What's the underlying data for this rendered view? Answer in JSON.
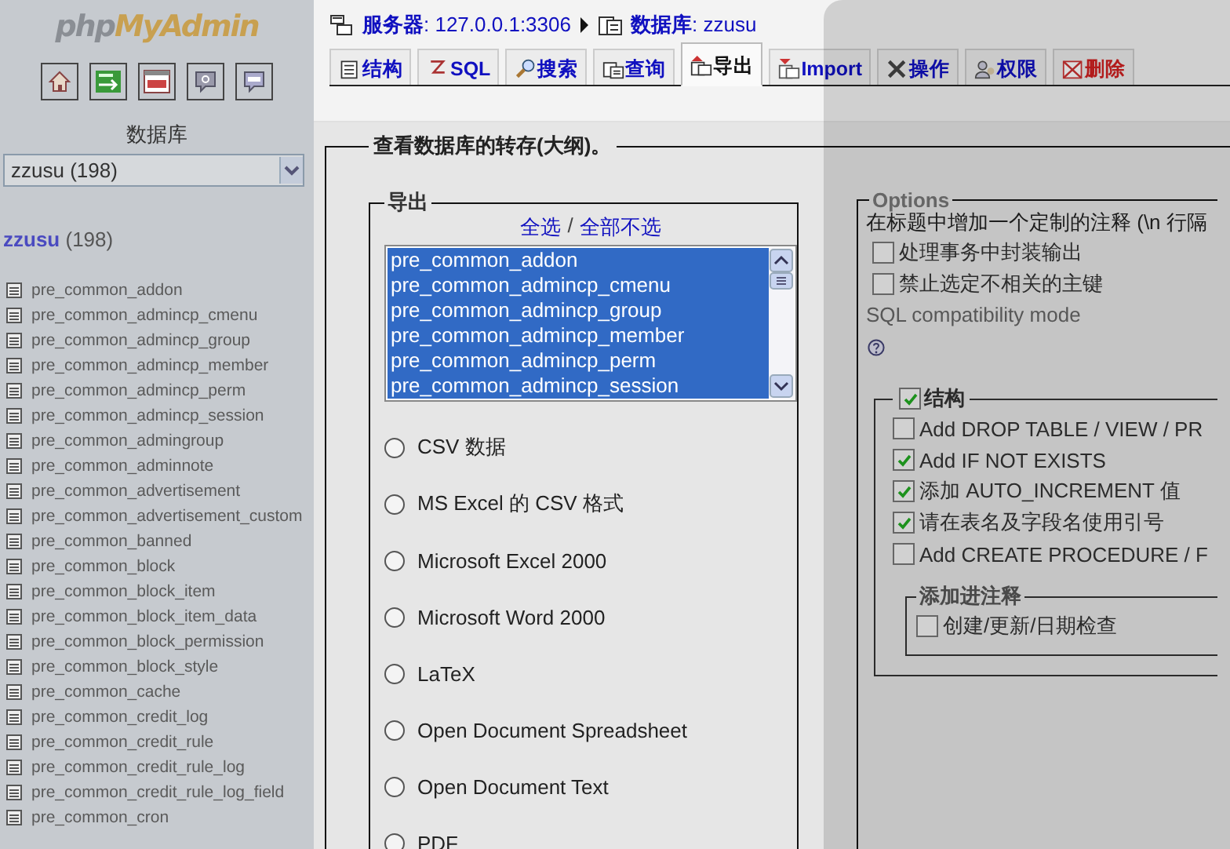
{
  "sidebar": {
    "logo": {
      "prefix": "php",
      "main": "MyAdmin"
    },
    "icon_buttons": [
      {
        "kind": "home"
      },
      {
        "kind": "exit"
      },
      {
        "kind": "sql"
      },
      {
        "kind": "help"
      },
      {
        "kind": "query"
      }
    ],
    "database_label": "数据库",
    "database_select": {
      "value": "zzusu (198)"
    },
    "current_db": {
      "name": "zzusu",
      "count": "(198)"
    },
    "tables": [
      "pre_common_addon",
      "pre_common_admincp_cmenu",
      "pre_common_admincp_group",
      "pre_common_admincp_member",
      "pre_common_admincp_perm",
      "pre_common_admincp_session",
      "pre_common_admingroup",
      "pre_common_adminnote",
      "pre_common_advertisement",
      "pre_common_advertisement_custom",
      "pre_common_banned",
      "pre_common_block",
      "pre_common_block_item",
      "pre_common_block_item_data",
      "pre_common_block_permission",
      "pre_common_block_style",
      "pre_common_cache",
      "pre_common_credit_log",
      "pre_common_credit_rule",
      "pre_common_credit_rule_log",
      "pre_common_credit_rule_log_field",
      "pre_common_cron"
    ]
  },
  "breadcrumb": {
    "server": "**服务器**: 127.0.0.1:3306",
    "database": "**数据库**: zzusu"
  },
  "tabs": [
    {
      "label": "结构",
      "kind": "structure",
      "selected": false
    },
    {
      "label": "SQL",
      "kind": "sql",
      "selected": false
    },
    {
      "label": "搜索",
      "kind": "search",
      "selected": false
    },
    {
      "label": "查询",
      "kind": "query",
      "selected": false
    },
    {
      "label": "导出",
      "kind": "export",
      "selected": true
    },
    {
      "label": "Import",
      "kind": "import",
      "selected": false
    },
    {
      "label": "操作",
      "kind": "operations",
      "selected": false
    },
    {
      "label": "权限",
      "kind": "privileges",
      "selected": false
    },
    {
      "label": "删除",
      "kind": "drop",
      "selected": false
    }
  ],
  "dump_title": "查看数据库的转存(大纲)。",
  "export": {
    "legend": "导出",
    "select_all": "全选",
    "separator": "/",
    "deselect_all": "全部不选",
    "tables": [
      {
        "name": "pre_common_addon",
        "selected": true
      },
      {
        "name": "pre_common_admincp_cmenu",
        "selected": true
      },
      {
        "name": "pre_common_admincp_group",
        "selected": true
      },
      {
        "name": "pre_common_admincp_member",
        "selected": true
      },
      {
        "name": "pre_common_admincp_perm",
        "selected": true
      },
      {
        "name": "pre_common_admincp_session",
        "selected": true
      }
    ],
    "formats": [
      {
        "label": "CSV 数据",
        "checked": false
      },
      {
        "label": "MS Excel 的  CSV 格式",
        "checked": false
      },
      {
        "label": "Microsoft Excel 2000",
        "checked": false
      },
      {
        "label": "Microsoft Word 2000",
        "checked": false
      },
      {
        "label": "LaTeX",
        "checked": false
      },
      {
        "label": "Open Document Spreadsheet",
        "checked": false
      },
      {
        "label": "Open Document Text",
        "checked": false
      },
      {
        "label": "PDF",
        "checked": false
      }
    ]
  },
  "options": {
    "legend": "Options",
    "comment_label": "在标题中增加一个定制的注释 (\\n 行隔",
    "checks": [
      {
        "label": "处理事务中封装输出",
        "checked": false
      },
      {
        "label": "禁止选定不相关的主键",
        "checked": false
      }
    ],
    "compat_label": "SQL compatibility mode",
    "structure": {
      "legend": "结构",
      "checked": true,
      "checks": [
        {
          "label": "Add DROP TABLE / VIEW / PR",
          "checked": false
        },
        {
          "label": "Add IF NOT EXISTS",
          "checked": true
        },
        {
          "label": "添加  AUTO_INCREMENT 值",
          "checked": true
        },
        {
          "label": "请在表名及字段名使用引号",
          "checked": true
        },
        {
          "label": "Add CREATE PROCEDURE / F",
          "checked": false
        }
      ],
      "comments": {
        "legend": "添加进注释",
        "checks": [
          {
            "label": "创建/更新/日期检查",
            "checked": false
          }
        ]
      }
    }
  }
}
